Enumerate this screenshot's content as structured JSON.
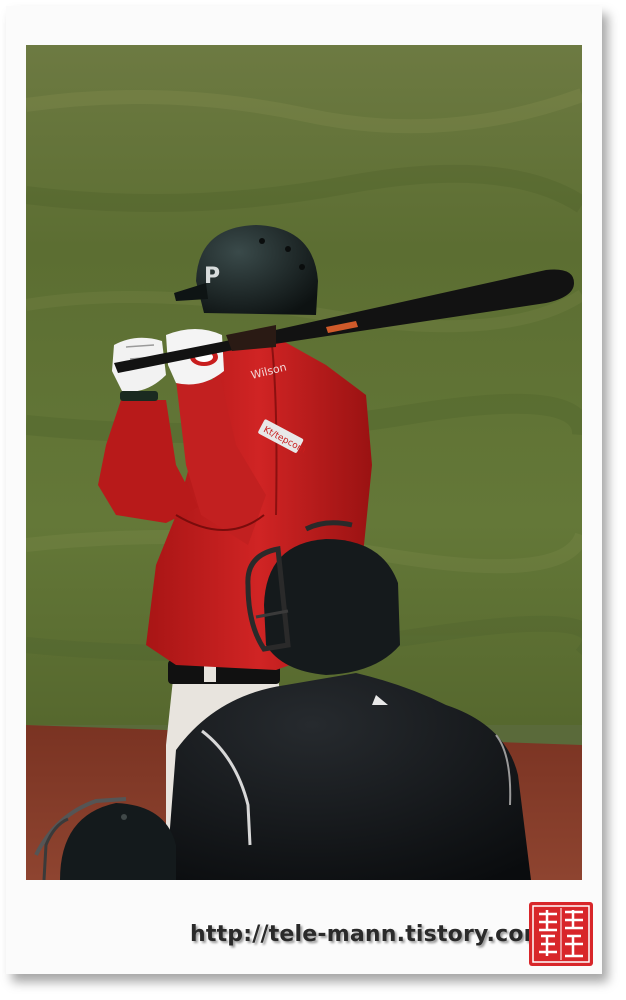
{
  "photo": {
    "subject": "baseball-batter-at-plate",
    "helmet_logo": "P",
    "jacket_brand": "Wilson",
    "jacket_patch": "Kt/tepcom",
    "colors": {
      "jacket": "#c81e1e",
      "grass": "#5f7036",
      "dirt": "#8a3a26",
      "bat": "#141414"
    }
  },
  "caption": {
    "url": "http://tele-mann.tistory.com"
  },
  "seal": {
    "text": "鄭瑞 善禧",
    "color": "#d8262a"
  }
}
